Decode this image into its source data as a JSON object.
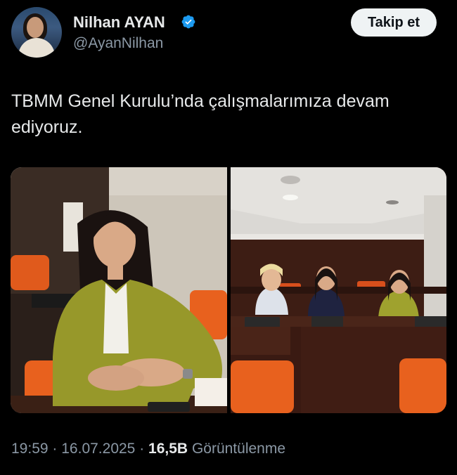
{
  "author": {
    "name": "Nilhan AYAN",
    "handle": "@AyanNilhan",
    "verified_color": "#1d9bf0"
  },
  "follow_label": "Takip et",
  "tweet": {
    "text": "TBMM Genel Kurulu’nda çalışmalarımıza devam ediyoruz."
  },
  "meta": {
    "time": "19:59",
    "sep1": "·",
    "date": "16.07.2025",
    "sep2": "·",
    "views": "16,5B",
    "views_label": "Görüntülenme"
  },
  "colors": {
    "background": "#000000",
    "text": "#e7e9ea",
    "muted": "#8b98a5",
    "button_bg": "#eff3f4"
  }
}
